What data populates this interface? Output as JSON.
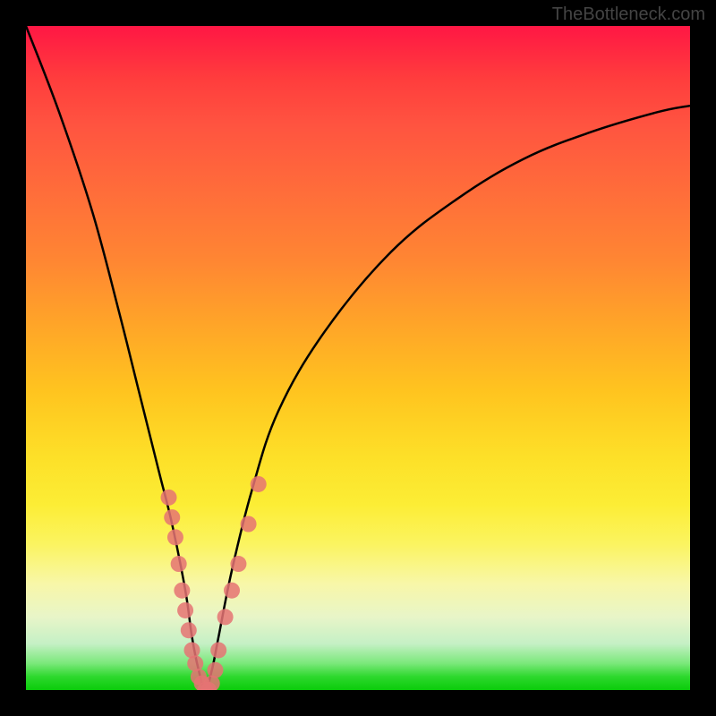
{
  "watermark": "TheBottleneck.com",
  "chart_data": {
    "type": "line",
    "title": "",
    "xlabel": "",
    "ylabel": "",
    "xlim": [
      0,
      100
    ],
    "ylim": [
      0,
      100
    ],
    "grid": false,
    "series": [
      {
        "name": "bottleneck-curve",
        "type": "line",
        "color": "#000000",
        "x": [
          0,
          5,
          10,
          14,
          17,
          20,
          22,
          24,
          25,
          26,
          27,
          28,
          29,
          31,
          34,
          38,
          45,
          55,
          65,
          75,
          85,
          95,
          100
        ],
        "y": [
          100,
          87,
          72,
          57,
          45,
          33,
          25,
          15,
          8,
          3,
          0,
          3,
          8,
          18,
          30,
          42,
          54,
          66,
          74,
          80,
          84,
          87,
          88
        ]
      },
      {
        "name": "data-points-left",
        "type": "scatter",
        "color": "#e57373",
        "x": [
          21.5,
          22.0,
          22.5,
          23.0,
          23.5,
          24.0,
          24.5,
          25.0,
          25.5,
          26.0,
          26.5,
          27.0,
          27.5,
          28.0
        ],
        "y": [
          29,
          26,
          23,
          19,
          15,
          12,
          9,
          6,
          4,
          2,
          1,
          0,
          0,
          1
        ]
      },
      {
        "name": "data-points-right",
        "type": "scatter",
        "color": "#e57373",
        "x": [
          28.5,
          29.0,
          30.0,
          31.0,
          32.0,
          33.5,
          35.0
        ],
        "y": [
          3,
          6,
          11,
          15,
          19,
          25,
          31
        ]
      }
    ]
  }
}
